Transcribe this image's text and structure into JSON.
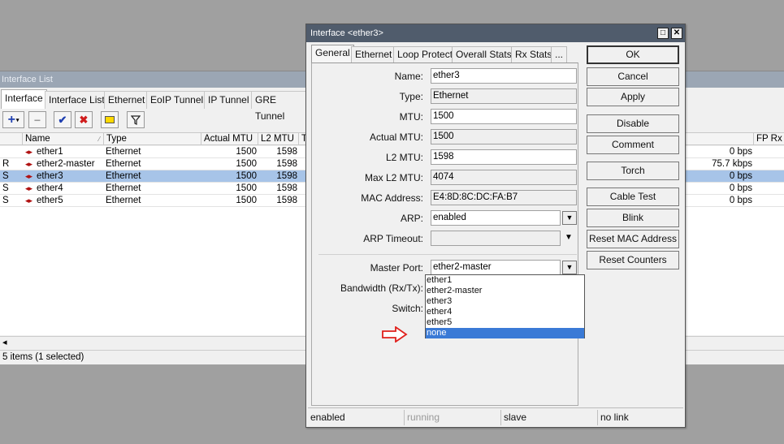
{
  "bg_window": {
    "title": "Interface List",
    "tabs": [
      "Interface",
      "Interface List",
      "Ethernet",
      "EoIP Tunnel",
      "IP Tunnel",
      "GRE Tunnel"
    ],
    "toolbar": [
      "add-icon",
      "remove-icon",
      "enable-icon",
      "disable-icon",
      "comment-icon",
      "filter-icon"
    ],
    "columns": {
      "flag": "",
      "name": "Name",
      "type": "Type",
      "actual_mtu": "Actual MTU",
      "l2_mtu": "L2 MTU",
      "t": "T",
      "fp_rx": "FP Rx"
    },
    "rows": [
      {
        "flag": "",
        "name": "ether1",
        "type": "Ethernet",
        "actual_mtu": "1500",
        "l2_mtu": "1598",
        "rate": "0 bps"
      },
      {
        "flag": "R",
        "name": "ether2-master",
        "type": "Ethernet",
        "actual_mtu": "1500",
        "l2_mtu": "1598",
        "rate": "75.7 kbps"
      },
      {
        "flag": "S",
        "name": "ether3",
        "type": "Ethernet",
        "actual_mtu": "1500",
        "l2_mtu": "1598",
        "rate": "0 bps"
      },
      {
        "flag": "S",
        "name": "ether4",
        "type": "Ethernet",
        "actual_mtu": "1500",
        "l2_mtu": "1598",
        "rate": "0 bps"
      },
      {
        "flag": "S",
        "name": "ether5",
        "type": "Ethernet",
        "actual_mtu": "1500",
        "l2_mtu": "1598",
        "rate": "0 bps"
      }
    ],
    "scroll_left": "◂",
    "status": "5 items (1 selected)"
  },
  "dialog": {
    "title": "Interface <ether3>",
    "tabs": [
      "General",
      "Ethernet",
      "Loop Protect",
      "Overall Stats",
      "Rx Stats",
      "..."
    ],
    "fields": {
      "name": {
        "label": "Name:",
        "value": "ether3"
      },
      "type": {
        "label": "Type:",
        "value": "Ethernet"
      },
      "mtu": {
        "label": "MTU:",
        "value": "1500"
      },
      "actual_mtu": {
        "label": "Actual MTU:",
        "value": "1500"
      },
      "l2_mtu": {
        "label": "L2 MTU:",
        "value": "1598"
      },
      "max_l2_mtu": {
        "label": "Max L2 MTU:",
        "value": "4074"
      },
      "mac": {
        "label": "MAC Address:",
        "value": "E4:8D:8C:DC:FA:B7"
      },
      "arp": {
        "label": "ARP:",
        "value": "enabled"
      },
      "arp_timeout": {
        "label": "ARP Timeout:",
        "value": ""
      },
      "master_port": {
        "label": "Master Port:",
        "value": "ether2-master"
      },
      "bandwidth": {
        "label": "Bandwidth (Rx/Tx):"
      },
      "switch": {
        "label": "Switch:"
      }
    },
    "master_port_options": [
      "ether1",
      "ether2-master",
      "ether3",
      "ether4",
      "ether5",
      "none"
    ],
    "master_port_highlighted": "none",
    "buttons": [
      "OK",
      "Cancel",
      "Apply",
      "Disable",
      "Comment",
      "Torch",
      "Cable Test",
      "Blink",
      "Reset MAC Address",
      "Reset Counters"
    ],
    "status": [
      "enabled",
      "running",
      "slave",
      "no link"
    ]
  },
  "colors": {
    "selection": "#a7c4e8",
    "list_highlight": "#3a7ad6",
    "arrow": "#e0201c"
  }
}
